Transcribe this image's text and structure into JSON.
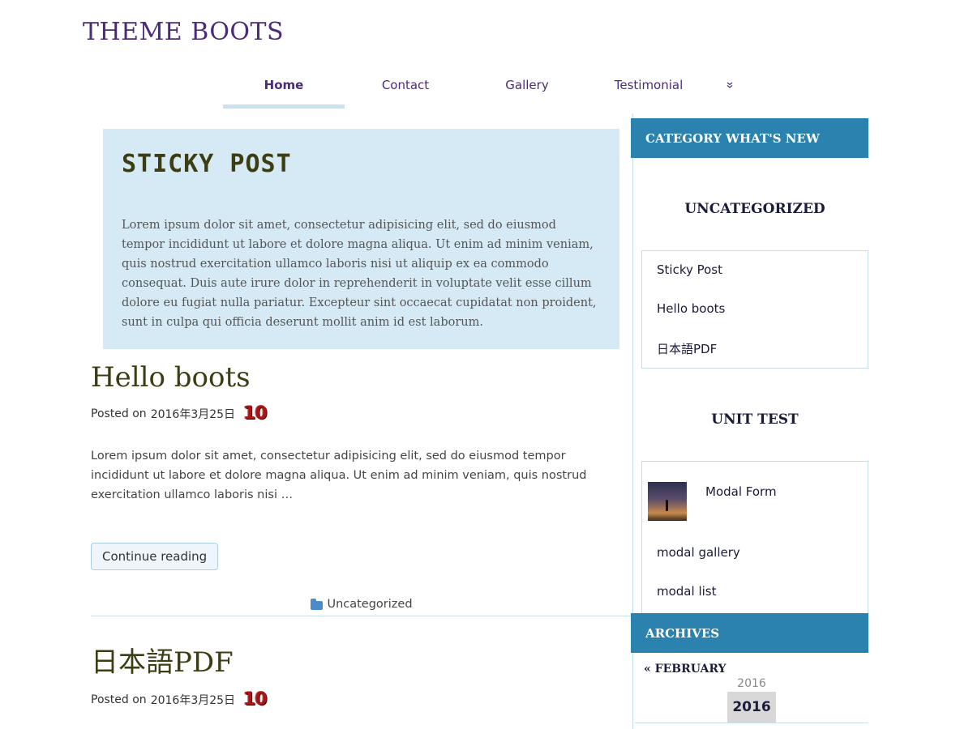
{
  "site": {
    "title": "THEME BOOTS"
  },
  "nav": {
    "items": [
      {
        "label": "Home",
        "active": true
      },
      {
        "label": "Contact"
      },
      {
        "label": "Gallery"
      },
      {
        "label": "Testimonial"
      }
    ],
    "more_icon": "chevron-double-down-icon"
  },
  "sticky": {
    "title": "STICKY POST",
    "text": "Lorem ipsum dolor sit amet, consectetur adipisicing elit, sed do eiusmod tempor incididunt ut labore et dolore magna aliqua. Ut enim ad minim veniam, quis nostrud exercitation ullamco laboris nisi ut aliquip ex ea commodo consequat. Duis aute irure dolor in reprehenderit in voluptate velit esse cillum dolore eu fugiat nulla pariatur. Excepteur sint occaecat cupidatat non proident, sunt in culpa qui officia deserunt mollit anim id est laborum."
  },
  "posts": [
    {
      "title": "Hello boots",
      "posted_on": "Posted on",
      "date": "2016年3月25日",
      "comments": "10",
      "excerpt": "Lorem ipsum dolor sit amet, consectetur adipisicing elit, sed do eiusmod tempor incididunt ut labore et dolore magna aliqua. Ut enim ad minim veniam, quis nostrud exercitation ullamco laboris nisi …",
      "continue_label": "Continue reading",
      "category": "Uncategorized"
    },
    {
      "title": "日本語PDF",
      "posted_on": "Posted on",
      "date": "2016年3月25日",
      "comments": "10"
    }
  ],
  "sidebar": {
    "whats_new_header": "CATEGORY WHAT'S NEW",
    "groups": [
      {
        "title": "UNCATEGORIZED",
        "links": [
          "Sticky Post",
          "Hello boots",
          "日本語PDF"
        ]
      },
      {
        "title": "UNIT TEST",
        "links": [
          "Modal Form",
          "modal gallery",
          "modal list"
        ]
      }
    ],
    "archives_header": "ARCHIVES",
    "archives_prev": "« FEBRUARY",
    "cal_caption": "2016",
    "cal_year": "2016"
  },
  "colors": {
    "accent": "#2b82ae",
    "brand": "#4a2b78",
    "sticky_bg": "#d6eaf5"
  }
}
